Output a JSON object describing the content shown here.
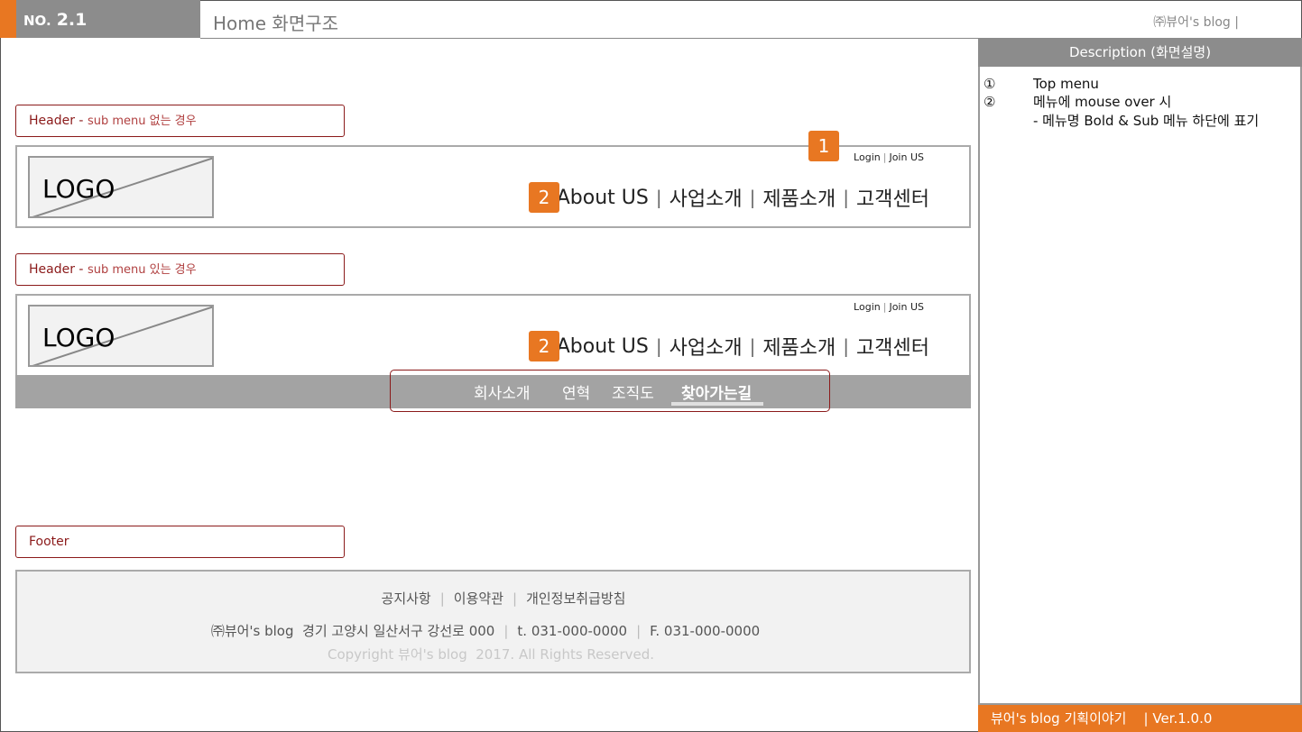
{
  "header": {
    "no_label": "NO.",
    "no_value": "2.1",
    "title": "Home 화면구조",
    "company": "㈜뷰어's blog"
  },
  "description": {
    "heading": "Description (화면설명)",
    "items": [
      {
        "marker": "①",
        "text": "Top menu"
      },
      {
        "marker": "②",
        "text": "메뉴에 mouse over 시"
      }
    ],
    "sub_text": "- 메뉴명 Bold & Sub 메뉴 하단에 표기"
  },
  "bottom_bar": "뷰어's blog 기획이야기    | Ver.1.0.0",
  "sections": {
    "header_no_sub": {
      "title": "Header -",
      "sub": "sub menu 없는 경우"
    },
    "header_with_sub": {
      "title": "Header -",
      "sub": "sub menu 있는 경우"
    },
    "footer": {
      "title": "Footer"
    }
  },
  "logo_text": "LOGO",
  "login": {
    "login": "Login",
    "join": "Join US",
    "sep": "|"
  },
  "gnb": [
    "About US",
    "사업소개",
    "제품소개",
    "고객센터"
  ],
  "gnb_sep": "|",
  "badges": {
    "one": "1",
    "two": "2"
  },
  "submenu": [
    "회사소개",
    "연혁",
    "조직도",
    "찾아가는길"
  ],
  "footer": {
    "links": [
      "공지사항",
      "이용약관",
      "개인정보취급방침"
    ],
    "info": [
      "㈜뷰어's blog  경기 고양시 일산서구 강선로 000",
      "t. 031-000-0000",
      "F. 031-000-0000"
    ],
    "sep": "|",
    "copyright": "Copyright 뷰어's blog  2017. All Rights Reserved."
  },
  "colors": {
    "accent": "#e87722",
    "gray": "#8c8c8c",
    "label": "#8b1a1a"
  }
}
